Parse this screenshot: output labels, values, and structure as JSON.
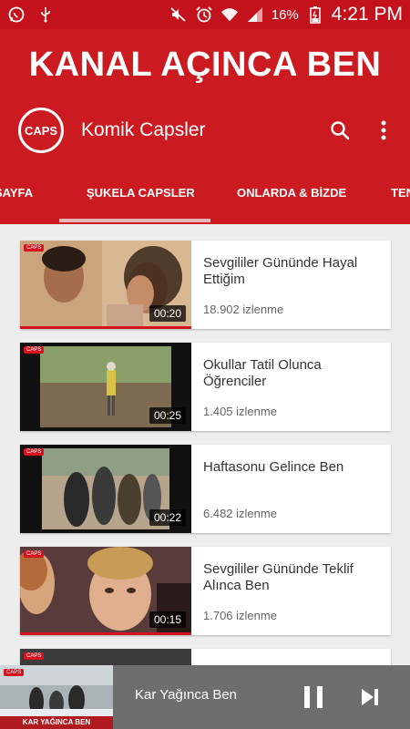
{
  "status_bar": {
    "icons_left": [
      "whatsapp-icon",
      "usb-icon"
    ],
    "icons_right": [
      "mute-icon",
      "alarm-icon",
      "wifi-icon",
      "signal-icon",
      "battery-icon"
    ],
    "battery_percent": "16%",
    "time": "4:21 PM"
  },
  "banner": {
    "title": "KANAL AÇINCA BEN"
  },
  "toolbar": {
    "logo_text": "CAPS",
    "channel_name": "Komik Capsler",
    "search_icon": "search-icon",
    "more_icon": "more-vert-icon"
  },
  "tabs": {
    "items": [
      {
        "label": "SAYFA"
      },
      {
        "label": "ŞUKELA CAPSLER"
      },
      {
        "label": "ONLARDA & BİZDE"
      },
      {
        "label": "TEN"
      }
    ],
    "selected": "ŞUKELA CAPSLER"
  },
  "videos": [
    {
      "title": "Sevgililer Gününde Hayal Ettiğim",
      "views": "18.902 izlenme",
      "duration": "00:20"
    },
    {
      "title": "Okullar Tatil Olunca Öğrenciler",
      "views": "1.405 izlenme",
      "duration": "00:25"
    },
    {
      "title": "Haftasonu Gelince Ben",
      "views": "6.482 izlenme",
      "duration": "00:22"
    },
    {
      "title": "Sevgililer Gününde Teklif Alınca Ben",
      "views": "1.706 izlenme",
      "duration": "00:15"
    }
  ],
  "player": {
    "thumb_label": "KAR YAĞINCA BEN",
    "title": "Kar Yağınca Ben",
    "pause_icon": "pause-icon",
    "next_icon": "skip-next-icon"
  },
  "colors": {
    "primary": "#cc1a21",
    "status_bar": "#c4121c",
    "accent_red": "#d6121e",
    "background": "#eeeeee",
    "player_bg": "#6e6e6e"
  }
}
